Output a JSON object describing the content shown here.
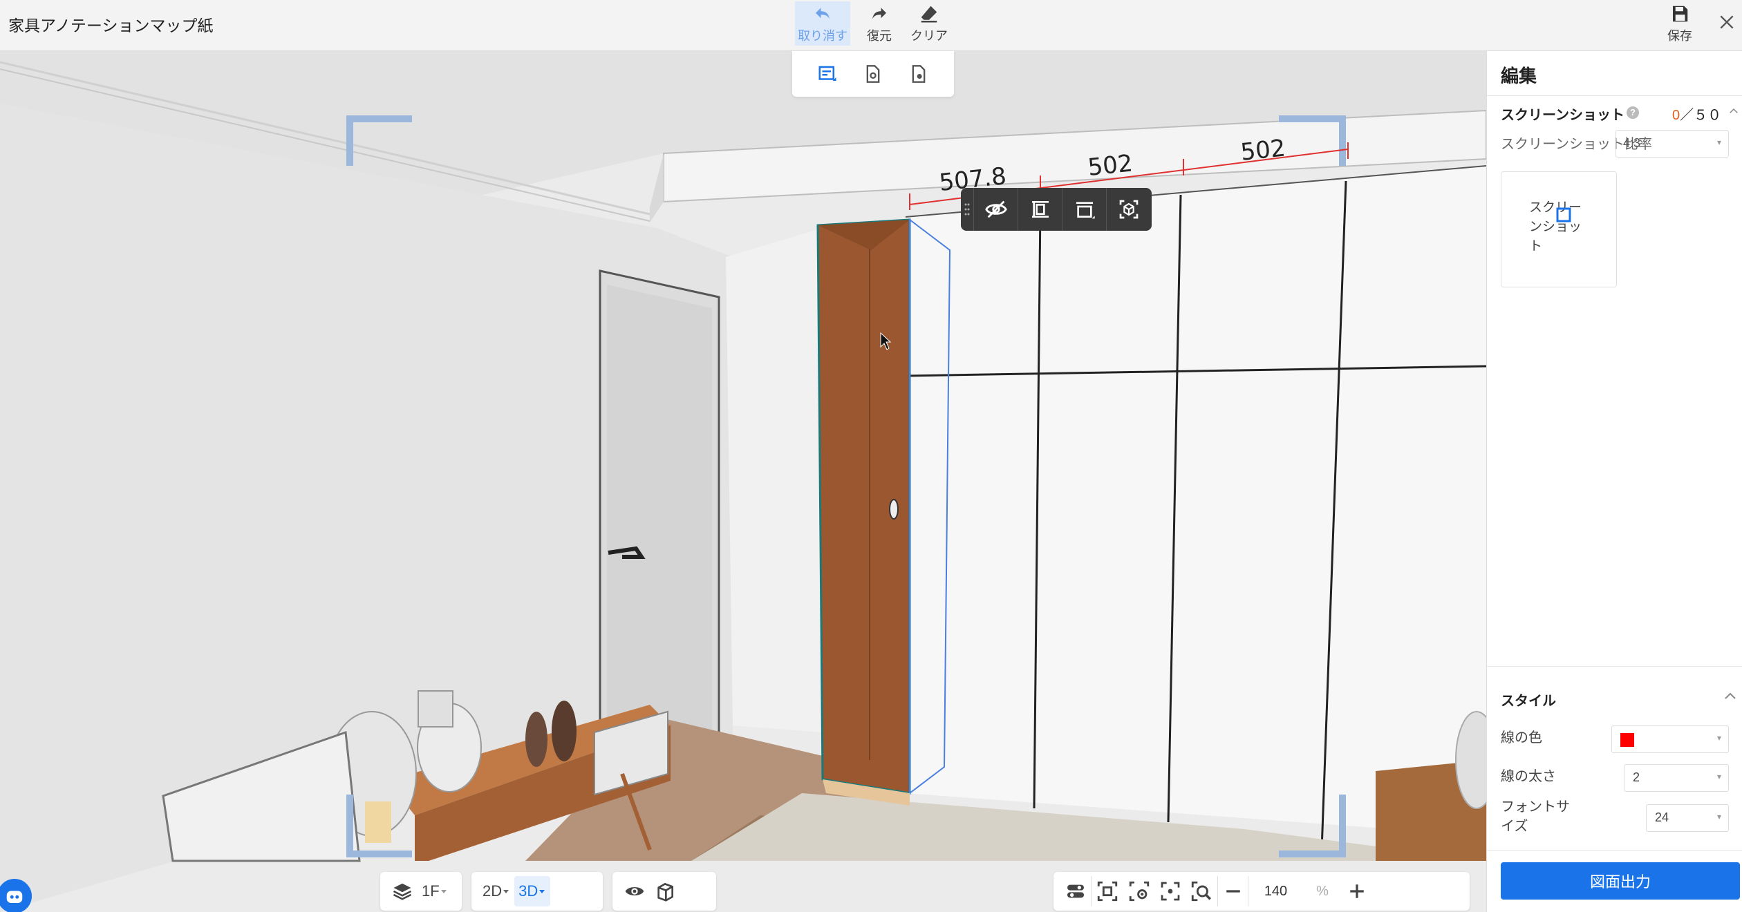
{
  "app": {
    "title": "家具アノテーションマップ紙"
  },
  "top_actions": {
    "undo": "取り消す",
    "redo": "復元",
    "clear": "クリア",
    "save": "保存"
  },
  "dimensions": {
    "d1": "507.8",
    "d2": "502",
    "d3": "502"
  },
  "bottom": {
    "floor": "1F",
    "view_2d": "2D",
    "view_3d": "3D",
    "zoom_value": "140",
    "zoom_unit": "%"
  },
  "panel": {
    "title": "編集",
    "screenshot_label": "スクリーンショット",
    "screenshot_count_current": "0",
    "screenshot_count_sep": "／",
    "screenshot_count_max": "５０",
    "ratio_label": "スクリーンショット比率",
    "ratio_value": "4:3",
    "screenshot_card_text": "スクリーンショット",
    "style_label": "スタイル",
    "line_color_label": "線の色",
    "line_color": "#ff0000",
    "line_width_label": "線の太さ",
    "line_width_value": "2",
    "font_size_label": "フォントサイズ",
    "font_size_value": "24",
    "export_button": "図面出力"
  }
}
